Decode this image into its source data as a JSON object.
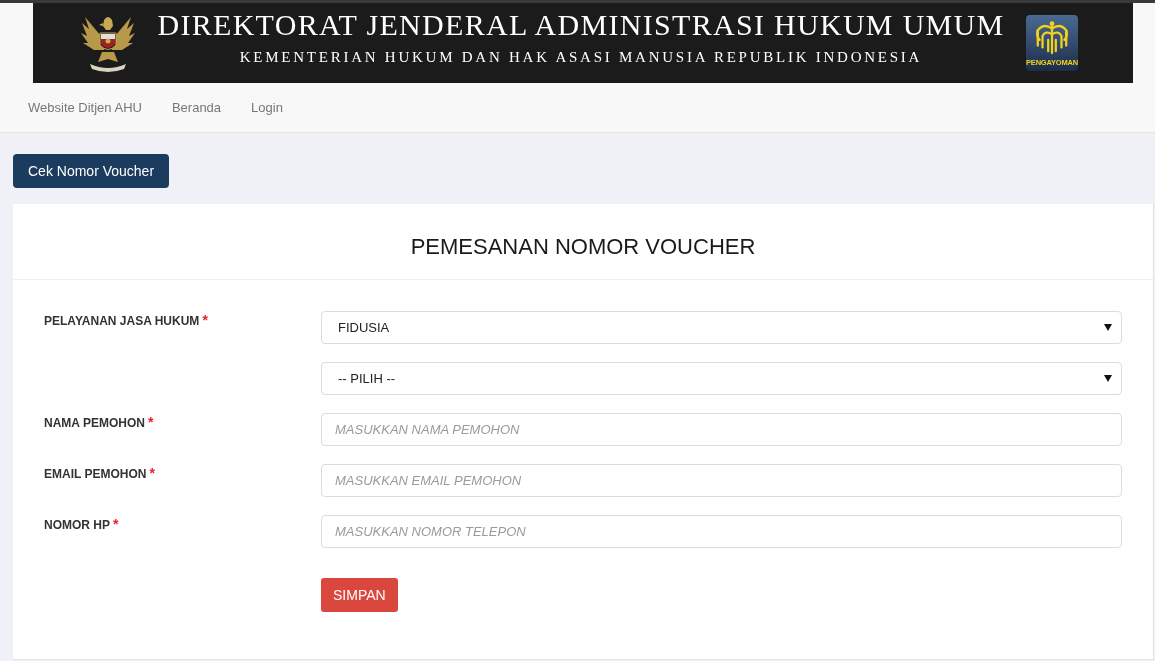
{
  "header": {
    "title": "DIREKTORAT JENDERAL ADMINISTRASI HUKUM UMUM",
    "subtitle": "KEMENTERIAN HUKUM DAN HAK ASASI MANUSIA REPUBLIK INDONESIA",
    "logo_caption": "PENGAYOMAN"
  },
  "nav_links": [
    "Website Ditjen AHU",
    "Beranda",
    "Login"
  ],
  "check_voucher_button": "Cek Nomor Voucher",
  "form": {
    "title": "PEMESANAN NOMOR VOUCHER",
    "fields": [
      {
        "kind": "select",
        "label": "PELAYANAN JASA HUKUM",
        "required_mark": "*",
        "value": "FIDUSIA"
      },
      {
        "kind": "select",
        "value": "-- PILIH --"
      },
      {
        "kind": "text",
        "label": "NAMA PEMOHON",
        "required_mark": "*",
        "placeholder": "MASUKKAN NAMA PEMOHON"
      },
      {
        "kind": "text",
        "label": "EMAIL PEMOHON",
        "required_mark": "*",
        "placeholder": "MASUKKAN EMAIL PEMOHON"
      },
      {
        "kind": "text",
        "label": "NOMOR HP",
        "required_mark": "*",
        "placeholder": "MASUKKAN NOMOR TELEPON"
      }
    ],
    "submit_button": "SIMPAN"
  }
}
